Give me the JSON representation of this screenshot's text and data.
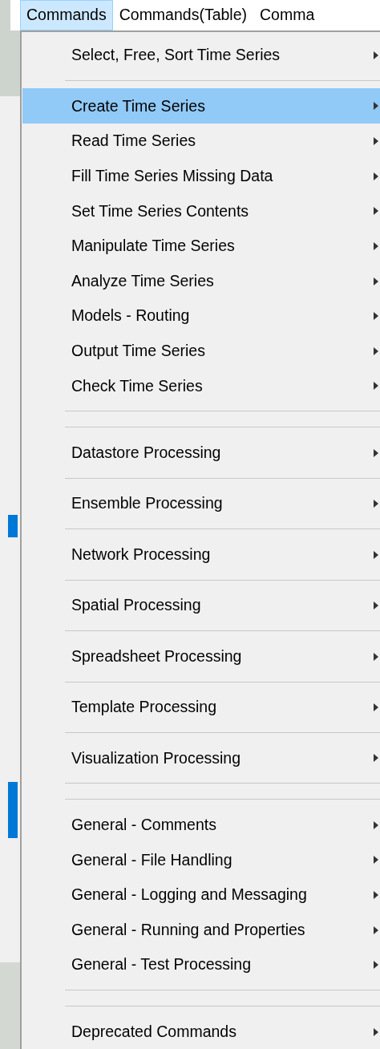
{
  "menubar": [
    {
      "label": "Commands",
      "selected": true
    },
    {
      "label": "Commands(Table)",
      "selected": false
    },
    {
      "label": "Comma",
      "selected": false
    }
  ],
  "menu": [
    {
      "kind": "item",
      "label": "Select, Free, Sort Time Series",
      "selected": false
    },
    {
      "kind": "separator"
    },
    {
      "kind": "item",
      "label": "Create Time Series",
      "selected": true
    },
    {
      "kind": "item",
      "label": "Read Time Series",
      "selected": false
    },
    {
      "kind": "item",
      "label": "Fill Time Series Missing Data",
      "selected": false
    },
    {
      "kind": "item",
      "label": "Set Time Series Contents",
      "selected": false
    },
    {
      "kind": "item",
      "label": "Manipulate Time Series",
      "selected": false
    },
    {
      "kind": "item",
      "label": "Analyze Time Series",
      "selected": false
    },
    {
      "kind": "item",
      "label": "Models - Routing",
      "selected": false
    },
    {
      "kind": "item",
      "label": "Output Time Series",
      "selected": false
    },
    {
      "kind": "item",
      "label": "Check Time Series",
      "selected": false
    },
    {
      "kind": "separator"
    },
    {
      "kind": "separator"
    },
    {
      "kind": "item",
      "label": "Datastore Processing",
      "selected": false
    },
    {
      "kind": "separator"
    },
    {
      "kind": "item",
      "label": "Ensemble Processing",
      "selected": false
    },
    {
      "kind": "separator"
    },
    {
      "kind": "item",
      "label": "Network Processing",
      "selected": false
    },
    {
      "kind": "separator"
    },
    {
      "kind": "item",
      "label": "Spatial Processing",
      "selected": false
    },
    {
      "kind": "separator"
    },
    {
      "kind": "item",
      "label": "Spreadsheet Processing",
      "selected": false
    },
    {
      "kind": "separator"
    },
    {
      "kind": "item",
      "label": "Template Processing",
      "selected": false
    },
    {
      "kind": "separator"
    },
    {
      "kind": "item",
      "label": "Visualization Processing",
      "selected": false
    },
    {
      "kind": "separator"
    },
    {
      "kind": "separator"
    },
    {
      "kind": "item",
      "label": "General - Comments",
      "selected": false
    },
    {
      "kind": "item",
      "label": "General - File Handling",
      "selected": false
    },
    {
      "kind": "item",
      "label": "General - Logging and Messaging",
      "selected": false
    },
    {
      "kind": "item",
      "label": "General - Running and Properties",
      "selected": false
    },
    {
      "kind": "item",
      "label": "General - Test Processing",
      "selected": false
    },
    {
      "kind": "separator"
    },
    {
      "kind": "separator"
    },
    {
      "kind": "item",
      "label": "Deprecated Commands",
      "selected": false
    }
  ]
}
